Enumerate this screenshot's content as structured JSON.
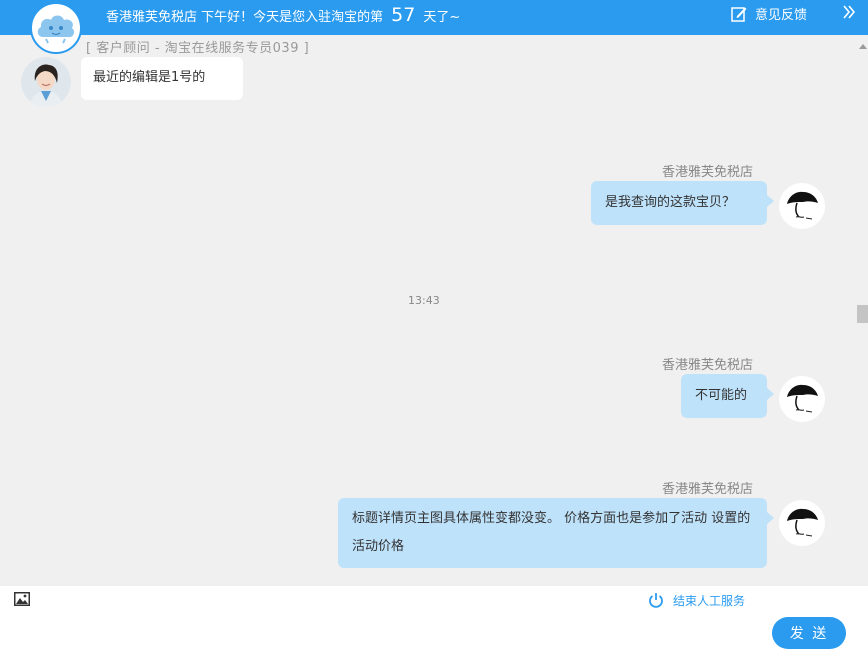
{
  "header": {
    "greeting_prefix": "香港雅芙免税店 下午好！今天是您入驻淘宝的第",
    "days": "57",
    "greeting_suffix": "天了~",
    "feedback_label": "意见反馈",
    "logo_icon": "cloud-mascot-icon",
    "feedback_icon": "edit-icon",
    "collapse_icon": "double-chevron-right-icon",
    "accent_color": "#2a9bef"
  },
  "agent": {
    "role_label": "[ 客户顾问  -  淘宝在线服务专员039 ]"
  },
  "messages": [
    {
      "side": "left",
      "text": "最近的编辑是1号的"
    },
    {
      "side": "right",
      "sender": "香港雅芙免税店",
      "text": "是我查询的这款宝贝？"
    },
    {
      "side": "right",
      "sender": "香港雅芙免税店",
      "text": "不可能的"
    },
    {
      "side": "right",
      "sender": "香港雅芙免税店",
      "text": "标题详情页主图具体属性变都没变。 价格方面也是参加了活动 设置的活动价格"
    }
  ],
  "timestamp": "13:43",
  "footer": {
    "image_tool_icon": "image-icon",
    "end_service_icon": "power-icon",
    "end_service_label": "结束人工服务",
    "send_label": "发 送"
  },
  "colors": {
    "user_bubble": "#bfe2fb",
    "agent_bubble": "#ffffff",
    "background": "#f0f0f0"
  }
}
